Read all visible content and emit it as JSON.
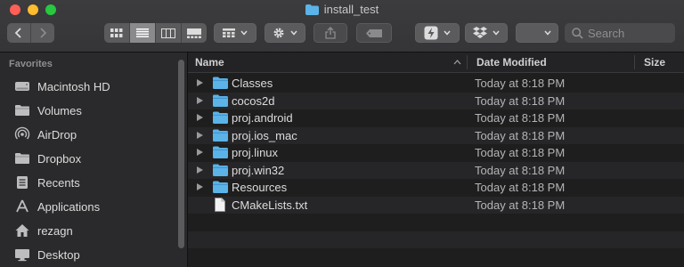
{
  "window": {
    "title": "install_test"
  },
  "toolbar": {
    "search_placeholder": "Search",
    "view_modes": [
      "icon-view",
      "list-view",
      "column-view",
      "gallery-view"
    ],
    "active_view": "list-view"
  },
  "sidebar": {
    "section": "Favorites",
    "items": [
      {
        "label": "Macintosh HD",
        "icon": "hard-drive-icon"
      },
      {
        "label": "Volumes",
        "icon": "folder-icon"
      },
      {
        "label": "AirDrop",
        "icon": "airdrop-icon"
      },
      {
        "label": "Dropbox",
        "icon": "folder-icon"
      },
      {
        "label": "Recents",
        "icon": "recents-icon"
      },
      {
        "label": "Applications",
        "icon": "applications-icon"
      },
      {
        "label": "rezagn",
        "icon": "home-icon"
      },
      {
        "label": "Desktop",
        "icon": "desktop-icon"
      }
    ]
  },
  "columns": {
    "name": "Name",
    "date": "Date Modified",
    "size": "Size"
  },
  "files": [
    {
      "name": "Classes",
      "date": "Today at 8:18 PM",
      "type": "folder"
    },
    {
      "name": "cocos2d",
      "date": "Today at 8:18 PM",
      "type": "folder"
    },
    {
      "name": "proj.android",
      "date": "Today at 8:18 PM",
      "type": "folder"
    },
    {
      "name": "proj.ios_mac",
      "date": "Today at 8:18 PM",
      "type": "folder"
    },
    {
      "name": "proj.linux",
      "date": "Today at 8:18 PM",
      "type": "folder"
    },
    {
      "name": "proj.win32",
      "date": "Today at 8:18 PM",
      "type": "folder"
    },
    {
      "name": "Resources",
      "date": "Today at 8:18 PM",
      "type": "folder"
    },
    {
      "name": "CMakeLists.txt",
      "date": "Today at 8:18 PM",
      "type": "file"
    }
  ],
  "colors": {
    "folder": "#5bb3e8",
    "background": "#1e1e1e",
    "sidebar": "#2a2a2c"
  }
}
